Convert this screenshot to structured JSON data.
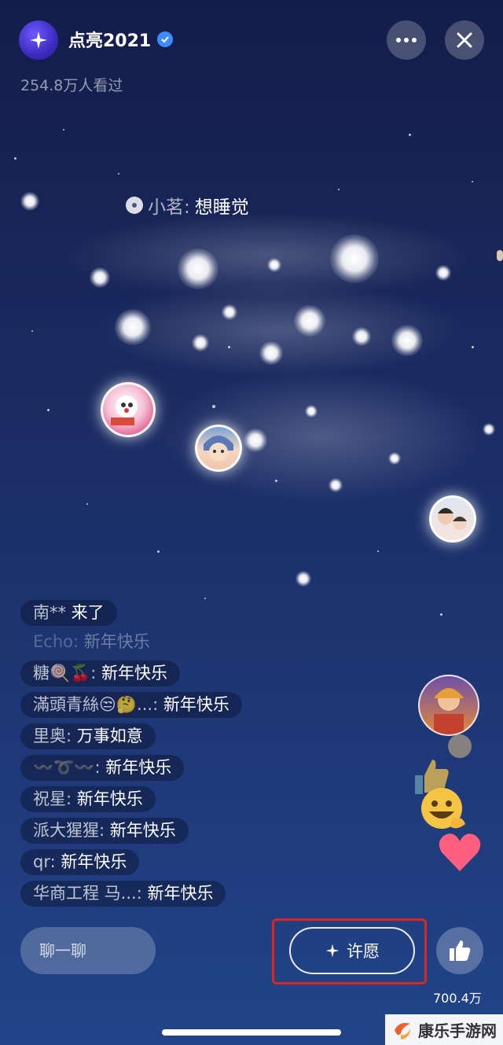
{
  "header": {
    "title": "点亮2021",
    "viewers": "254.8万人看过"
  },
  "wish_bubble": {
    "name": "小茗:",
    "message": "想睡觉"
  },
  "chat": {
    "messages": [
      {
        "user": "南**",
        "text": " 来了",
        "faded": false
      },
      {
        "user": "Echo:",
        "text": " 新年快乐",
        "faded": true
      },
      {
        "user": "糖🍭🍒:",
        "text": " 新年快乐",
        "faded": false
      },
      {
        "user": "滿頭青絲😒🤔...:",
        "text": " 新年快乐",
        "faded": false
      },
      {
        "user": "里奥:",
        "text": " 万事如意",
        "faded": false
      },
      {
        "user": "〰️➰〰️:",
        "text": " 新年快乐",
        "faded": false
      },
      {
        "user": "祝星:",
        "text": " 新年快乐",
        "faded": false
      },
      {
        "user": "派大猩猩:",
        "text": " 新年快乐",
        "faded": false
      },
      {
        "user": "qr:",
        "text": " 新年快乐",
        "faded": false
      },
      {
        "user": "华商工程  马...:",
        "text": " 新年快乐",
        "faded": false
      }
    ]
  },
  "bottom": {
    "chat_placeholder": "聊一聊",
    "wish_label": "许愿",
    "like_count": "700.4万"
  },
  "watermark": "康乐手游网",
  "colors": {
    "highlight": "#e0241f",
    "verified": "#3d8bff"
  }
}
